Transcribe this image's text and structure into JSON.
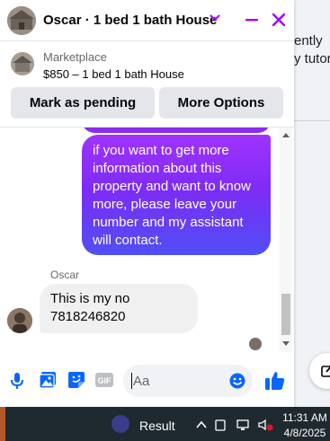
{
  "background": {
    "text_line1": "ently",
    "text_line2": "y tutor"
  },
  "chat": {
    "title": "Oscar · 1 bed 1 bath House",
    "marketplace": {
      "label": "Marketplace",
      "item": "$850 – 1 bed 1 bath House",
      "pending_button": "Mark as pending",
      "more_button": "More Options"
    },
    "messages": [
      {
        "direction": "outgoing",
        "text": "if you want to get more information about this property and want to know more, please leave your number and my assistant will contact."
      },
      {
        "direction": "incoming",
        "sender": "Oscar",
        "text": "This is my no 7818246820"
      }
    ],
    "composer": {
      "placeholder": "Aa",
      "icons": [
        "microphone-icon",
        "photo-icon",
        "sticker-icon",
        "gif-icon",
        "emoji-icon",
        "like-icon"
      ]
    },
    "accent_color": "#a100ff"
  },
  "taskbar": {
    "result_label": "Result",
    "time": "11:31 AM",
    "date": "4/8/2025"
  }
}
